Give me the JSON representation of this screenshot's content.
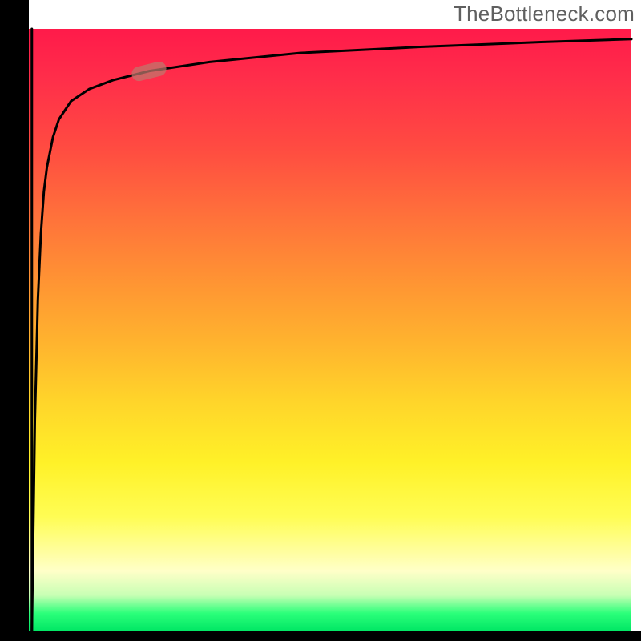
{
  "watermark": "TheBottleneck.com",
  "colors": {
    "axis": "#000000",
    "curve": "#000000",
    "marker": "rgba(190,120,110,0.72)",
    "text": "#606060"
  },
  "chart_data": {
    "type": "line",
    "title": "",
    "xlabel": "",
    "ylabel": "",
    "xlim": [
      0,
      100
    ],
    "ylim": [
      0,
      100
    ],
    "grid": false,
    "legend": null,
    "series": [
      {
        "name": "curve",
        "x": [
          0.5,
          1,
          1.5,
          2,
          2.5,
          3,
          4,
          5,
          7,
          10,
          14,
          20,
          30,
          45,
          65,
          85,
          100
        ],
        "y": [
          0,
          35,
          55,
          66,
          73,
          77,
          82,
          85,
          88,
          90,
          91.5,
          93,
          94.5,
          96,
          97,
          97.8,
          98.3
        ]
      },
      {
        "name": "vertical-drop",
        "x": [
          0.5,
          0.5
        ],
        "y": [
          100,
          0
        ]
      }
    ],
    "annotations": [
      {
        "type": "marker",
        "x": 20,
        "y": 93,
        "shape": "pill",
        "angle_deg": -14
      }
    ]
  }
}
